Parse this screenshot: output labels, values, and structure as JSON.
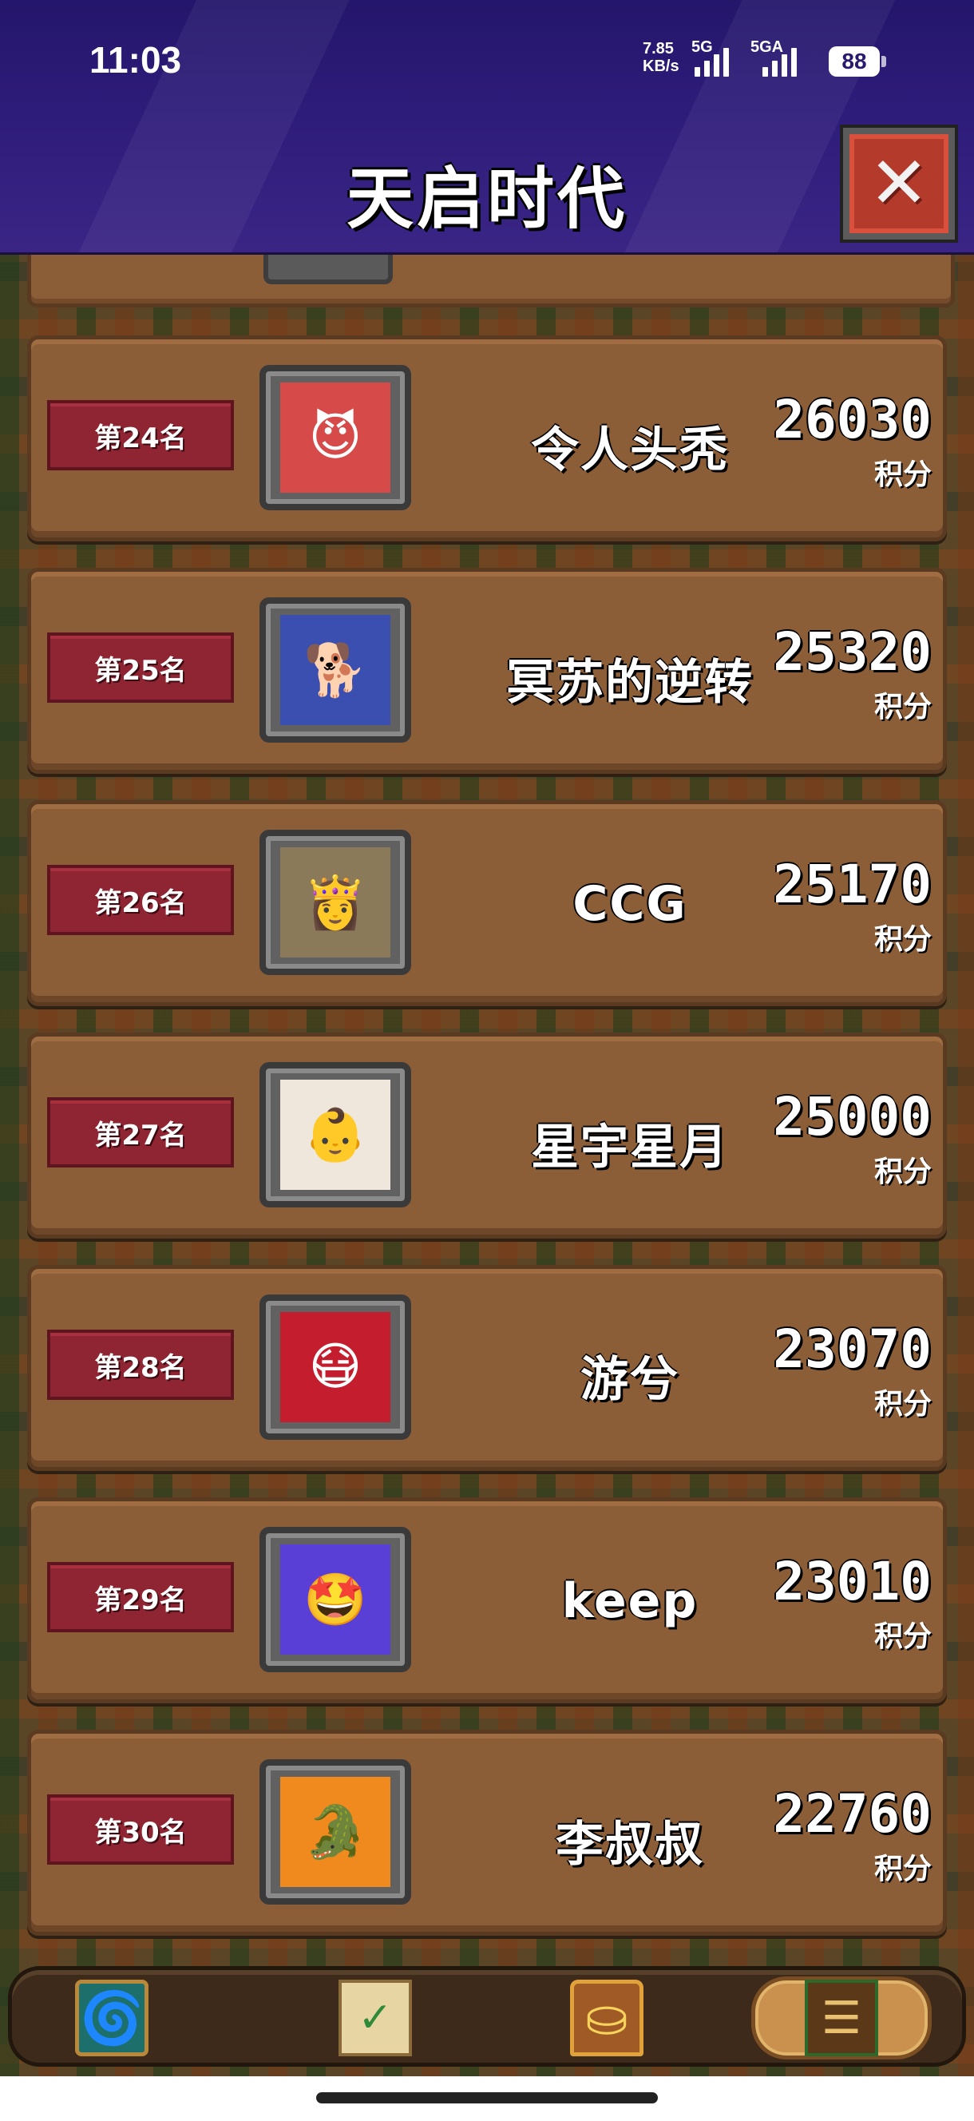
{
  "status_bar": {
    "time": "11:03",
    "net_speed": "7.85 KB/s",
    "net_speed_value": "7.85",
    "net_speed_unit": "KB/s",
    "signal_1": "5G",
    "signal_2": "5GA",
    "battery": "88"
  },
  "header": {
    "title": "天启时代",
    "close_icon": "close-x-icon"
  },
  "rankings": [
    {
      "rank": "第24名",
      "name": "令人头秃",
      "score": "26030",
      "unit": "积分",
      "avatar_bg": "#d64a4a",
      "avatar_glyph": "😈"
    },
    {
      "rank": "第25名",
      "name": "冥苏的逆转",
      "score": "25320",
      "unit": "积分",
      "avatar_bg": "#3a4fb0",
      "avatar_glyph": "🐕"
    },
    {
      "rank": "第26名",
      "name": "CCG",
      "score": "25170",
      "unit": "积分",
      "avatar_bg": "#8b7a5a",
      "avatar_glyph": "👸"
    },
    {
      "rank": "第27名",
      "name": "星宇星月",
      "score": "25000",
      "unit": "积分",
      "avatar_bg": "#efe6dc",
      "avatar_glyph": "👶"
    },
    {
      "rank": "第28名",
      "name": "游兮",
      "score": "23070",
      "unit": "积分",
      "avatar_bg": "#c41e2e",
      "avatar_glyph": "😷"
    },
    {
      "rank": "第29名",
      "name": "keep",
      "score": "23010",
      "unit": "积分",
      "avatar_bg": "#5a3fd6",
      "avatar_glyph": "🤩"
    },
    {
      "rank": "第30名",
      "name": "李叔叔",
      "score": "22760",
      "unit": "积分",
      "avatar_bg": "#f08a1e",
      "avatar_glyph": "🐊"
    }
  ],
  "bottom_nav": [
    {
      "id": "cards",
      "icon": "spiral-card-icon",
      "glyph": "🌀"
    },
    {
      "id": "tasks",
      "icon": "scroll-checklist-icon",
      "glyph": "✓"
    },
    {
      "id": "chest",
      "icon": "treasure-chest-icon",
      "glyph": "⛀"
    },
    {
      "id": "rank",
      "icon": "leaderboard-icon",
      "glyph": "☰",
      "selected": true
    }
  ]
}
